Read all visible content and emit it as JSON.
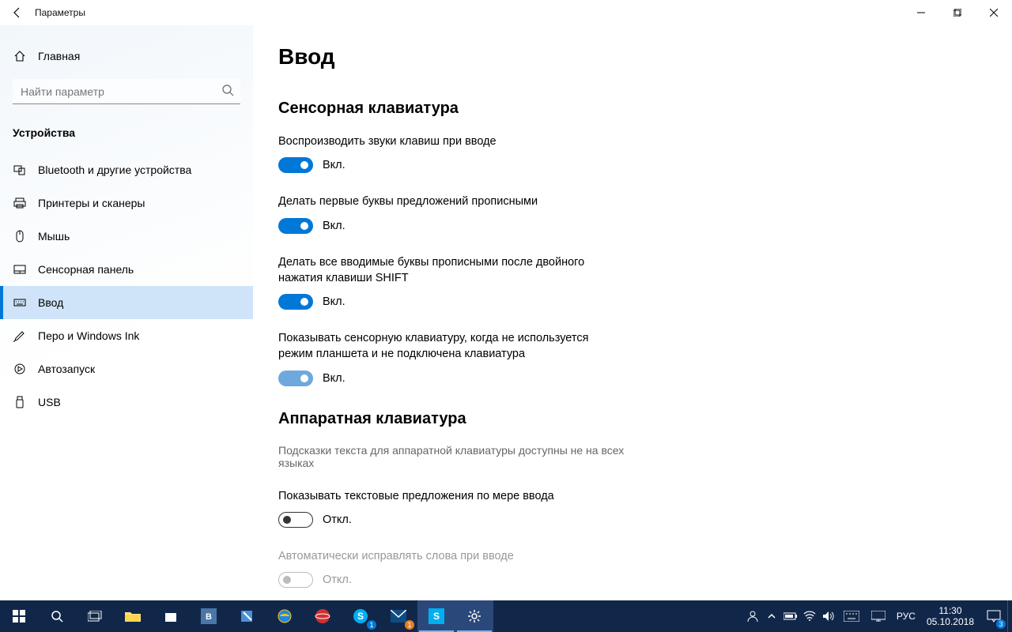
{
  "window": {
    "title": "Параметры"
  },
  "sidebar": {
    "home_label": "Главная",
    "search_placeholder": "Найти параметр",
    "group_title": "Устройства",
    "items": [
      {
        "label": "Bluetooth и другие устройства"
      },
      {
        "label": "Принтеры и сканеры"
      },
      {
        "label": "Мышь"
      },
      {
        "label": "Сенсорная панель"
      },
      {
        "label": "Ввод"
      },
      {
        "label": "Перо и Windows Ink"
      },
      {
        "label": "Автозапуск"
      },
      {
        "label": "USB"
      }
    ]
  },
  "main": {
    "page_title": "Ввод",
    "section1_title": "Сенсорная клавиатура",
    "settings1": [
      {
        "label": "Воспроизводить звуки клавиш при вводе",
        "state_label": "Вкл."
      },
      {
        "label": "Делать первые буквы предложений прописными",
        "state_label": "Вкл."
      },
      {
        "label": "Делать все вводимые буквы прописными после двойного нажатия клавиши SHIFT",
        "state_label": "Вкл."
      },
      {
        "label": "Показывать сенсорную клавиатуру, когда не используется режим планшета и не подключена клавиатура",
        "state_label": "Вкл."
      }
    ],
    "section2_title": "Аппаратная клавиатура",
    "section2_hint": "Подсказки текста для аппаратной клавиатуры доступны не на всех языках",
    "settings2": [
      {
        "label": "Показывать текстовые предложения по мере ввода",
        "state_label": "Откл."
      },
      {
        "label": "Автоматически исправлять слова при вводе",
        "state_label": "Откл."
      }
    ]
  },
  "taskbar": {
    "lang": "РУС",
    "time": "11:30",
    "date": "05.10.2018",
    "notif_count": "3",
    "skype_badge": "1",
    "mail_badge": "1"
  }
}
